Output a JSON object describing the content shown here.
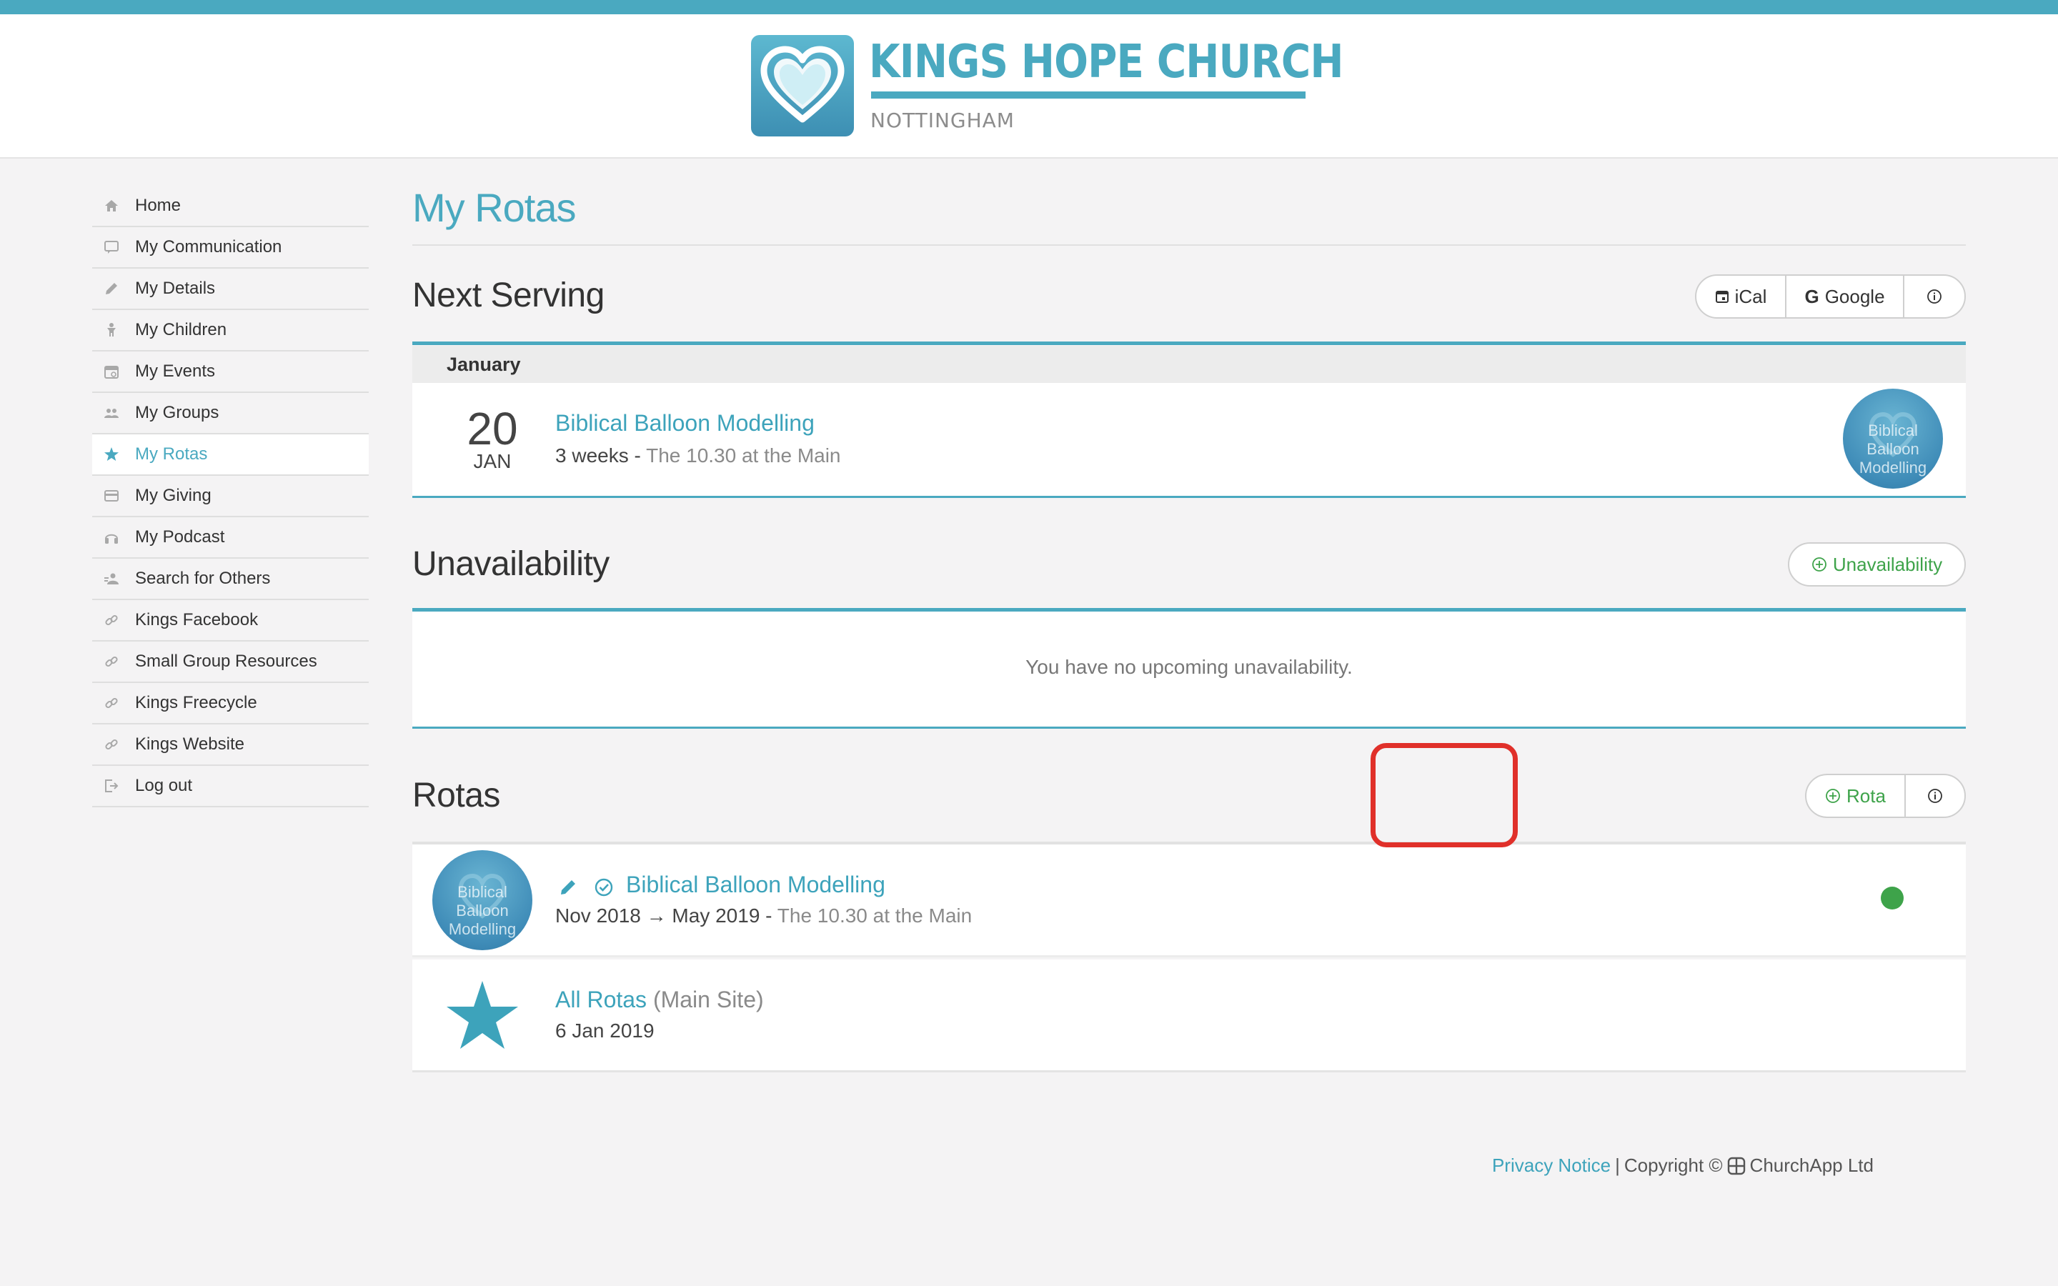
{
  "brand": {
    "name": "KINGS HOPE CHURCH",
    "location": "NOTTINGHAM",
    "accent_color": "#4aa9c0"
  },
  "sidebar": {
    "items": [
      {
        "label": "Home",
        "icon": "home-icon"
      },
      {
        "label": "My Communication",
        "icon": "chat-icon"
      },
      {
        "label": "My Details",
        "icon": "pencil-icon"
      },
      {
        "label": "My Children",
        "icon": "child-icon"
      },
      {
        "label": "My Events",
        "icon": "calendar-icon"
      },
      {
        "label": "My Groups",
        "icon": "group-icon"
      },
      {
        "label": "My Rotas",
        "icon": "star-icon",
        "active": true
      },
      {
        "label": "My Giving",
        "icon": "card-icon"
      },
      {
        "label": "My Podcast",
        "icon": "headphones-icon"
      },
      {
        "label": "Search for Others",
        "icon": "people-search-icon"
      },
      {
        "label": "Kings Facebook",
        "icon": "link-icon"
      },
      {
        "label": "Small Group Resources",
        "icon": "link-icon"
      },
      {
        "label": "Kings Freecycle",
        "icon": "link-icon"
      },
      {
        "label": "Kings Website",
        "icon": "link-icon"
      },
      {
        "label": "Log out",
        "icon": "logout-icon"
      }
    ]
  },
  "page": {
    "title": "My Rotas"
  },
  "next_serving": {
    "title": "Next Serving",
    "buttons": {
      "ical": "iCal",
      "google": "Google"
    },
    "month": "January",
    "item": {
      "day": "20",
      "month_short": "JAN",
      "title": "Biblical Balloon Modelling",
      "when": "3 weeks",
      "separator": " - ",
      "service": "The 10.30 at the Main",
      "avatar_text": "Biblical Balloon Modelling"
    }
  },
  "unavailability": {
    "title": "Unavailability",
    "add_button": "Unavailability",
    "empty_message": "You have no upcoming unavailability."
  },
  "rotas": {
    "title": "Rotas",
    "add_button": "Rota",
    "items": [
      {
        "title": "Biblical Balloon Modelling",
        "range": "Nov 2018 → May 2019",
        "separator": " - ",
        "service": "The 10.30 at the Main",
        "avatar_text": "Biblical Balloon Modelling",
        "status_color": "#3ea34a"
      },
      {
        "title": "All Rotas",
        "site": "(Main Site)",
        "date": "6 Jan 2019"
      }
    ]
  },
  "footer": {
    "privacy": "Privacy Notice",
    "separator": "|",
    "copyright": "Copyright ©",
    "company": "ChurchApp Ltd"
  }
}
